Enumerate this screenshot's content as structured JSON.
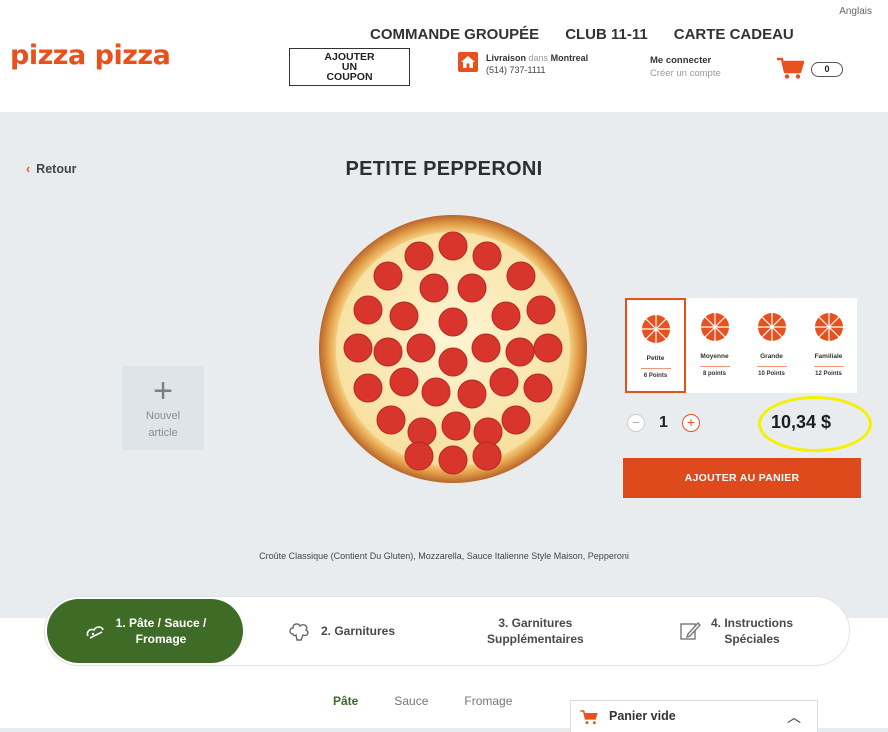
{
  "header": {
    "language": "Anglais",
    "logo": "pizza pizza",
    "nav": [
      "COMMANDE GROUPÉE",
      "CLUB 11-11",
      "CARTE CADEAU"
    ],
    "coupon_button": "AJOUTER\nUN\nCOUPON",
    "delivery": {
      "label": "Livraison",
      "dans": "dans",
      "city": "Montreal",
      "phone": "(514) 737-1111"
    },
    "login": {
      "line1": "Me connecter",
      "line2": "Créer un compte"
    },
    "cart_count": "0"
  },
  "product": {
    "back_label": "Retour",
    "title": "PETITE PEPPERONI",
    "new_item_label": "Nouvel\narticle",
    "sizes": [
      {
        "name": "Petite",
        "points": "6 Points",
        "selected": true
      },
      {
        "name": "Moyenne",
        "points": "8 points",
        "selected": false
      },
      {
        "name": "Grande",
        "points": "10 Points",
        "selected": false
      },
      {
        "name": "Familiale",
        "points": "12 Points",
        "selected": false
      }
    ],
    "quantity": "1",
    "price": "10,34 $",
    "add_to_cart": "AJOUTER AU PANIER",
    "ingredients": "Croûte Classique (Contient Du Gluten), Mozzarella, Sauce Italienne Style Maison, Pepperoni"
  },
  "steps": [
    {
      "label": "1. Pâte / Sauce /\nFromage",
      "icon": "dough-icon",
      "active": true
    },
    {
      "label": "2. Garnitures",
      "icon": "toppings-icon",
      "active": false
    },
    {
      "label": "3. Garnitures\nSupplémentaires",
      "icon": "",
      "active": false
    },
    {
      "label": "4. Instructions\nSpéciales",
      "icon": "edit-icon",
      "active": false
    }
  ],
  "tabs": [
    "Pâte",
    "Sauce",
    "Fromage"
  ],
  "panier": {
    "label": "Panier vide"
  },
  "colors": {
    "brand": "#e8501e",
    "green": "#3e6b25",
    "highlight": "#f4f000"
  }
}
